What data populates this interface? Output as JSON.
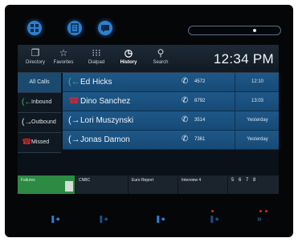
{
  "toolbar": {
    "items": [
      {
        "label": "Directory",
        "icon": "directory-icon"
      },
      {
        "label": "Favorites",
        "icon": "star-icon"
      },
      {
        "label": "Dialpad",
        "icon": "dialpad-icon"
      },
      {
        "label": "History",
        "icon": "history-icon"
      },
      {
        "label": "Search",
        "icon": "search-icon"
      }
    ],
    "active": "History",
    "clock": "12:34 PM"
  },
  "filters": [
    {
      "label": "All Calls",
      "icon": ""
    },
    {
      "label": "Inbound",
      "icon": "inbound-arrow-icon"
    },
    {
      "label": "Outbound",
      "icon": "outbound-arrow-icon"
    },
    {
      "label": "Missed",
      "icon": "missed-call-icon"
    }
  ],
  "calls": [
    {
      "name": "Ed Hicks",
      "ext": "4572",
      "time": "12:10",
      "direction": "inbound"
    },
    {
      "name": "Dino Sanchez",
      "ext": "8792",
      "time": "13:03",
      "direction": "missed"
    },
    {
      "name": "Lori Muszynski",
      "ext": "3514",
      "time": "Yesterday",
      "direction": "outbound"
    },
    {
      "name": "Jonas Damon",
      "ext": "7361",
      "time": "Yesterday",
      "direction": "outbound"
    }
  ],
  "status_strip": [
    {
      "label": "Failures",
      "color": "#2c8a43"
    },
    {
      "label": "CNBC",
      "color": "#1b232c"
    },
    {
      "label": "Euro Report",
      "color": "#1b232c"
    },
    {
      "label": "Interview 4",
      "color": "#1b232c"
    },
    {
      "label": "5 6 7 8",
      "color": "#1b232c"
    }
  ],
  "colors": {
    "accent": "#2f7fd0",
    "row_blue": "#1e5888",
    "inbound": "#3fbf6a",
    "missed": "#d8262c",
    "outbound": "#e8eef5"
  }
}
